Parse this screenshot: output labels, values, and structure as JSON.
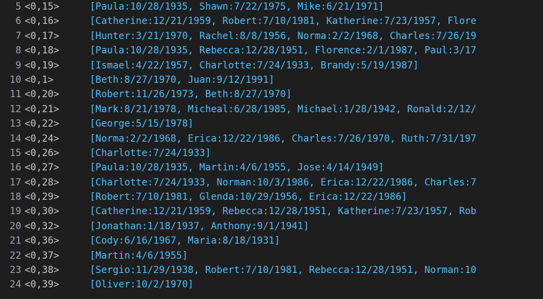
{
  "colors": {
    "background": "#1e1e1e",
    "line_number": "#9da5b4",
    "key": "#c8c8c8",
    "value": "#4fc1ff"
  },
  "lines": [
    {
      "number": "5",
      "key": "<0,15>",
      "value": "[Paula:10/28/1935, Shawn:7/22/1975, Mike:6/21/1971]"
    },
    {
      "number": "6",
      "key": "<0,16>",
      "value": "[Catherine:12/21/1959, Robert:7/10/1981, Katherine:7/23/1957, Flore"
    },
    {
      "number": "7",
      "key": "<0,17>",
      "value": "[Hunter:3/21/1970, Rachel:8/8/1956, Norma:2/2/1968, Charles:7/26/19"
    },
    {
      "number": "8",
      "key": "<0,18>",
      "value": "[Paula:10/28/1935, Rebecca:12/28/1951, Florence:2/1/1987, Paul:3/17"
    },
    {
      "number": "9",
      "key": "<0,19>",
      "value": "[Ismael:4/22/1957, Charlotte:7/24/1933, Brandy:5/19/1987]"
    },
    {
      "number": "10",
      "key": "<0,1>",
      "value": "[Beth:8/27/1970, Juan:9/12/1991]"
    },
    {
      "number": "11",
      "key": "<0,20>",
      "value": "[Robert:11/26/1973, Beth:8/27/1970]"
    },
    {
      "number": "12",
      "key": "<0,21>",
      "value": "[Mark:8/21/1978, Micheal:6/28/1985, Michael:1/28/1942, Ronald:2/12/"
    },
    {
      "number": "13",
      "key": "<0,22>",
      "value": "[George:5/15/1978]"
    },
    {
      "number": "14",
      "key": "<0,24>",
      "value": "[Norma:2/2/1968, Erica:12/22/1986, Charles:7/26/1970, Ruth:7/31/197"
    },
    {
      "number": "15",
      "key": "<0,26>",
      "value": "[Charlotte:7/24/1933]"
    },
    {
      "number": "16",
      "key": "<0,27>",
      "value": "[Paula:10/28/1935, Martin:4/6/1955, Jose:4/14/1949]"
    },
    {
      "number": "17",
      "key": "<0,28>",
      "value": "[Charlotte:7/24/1933, Norman:10/3/1986, Erica:12/22/1986, Charles:7"
    },
    {
      "number": "18",
      "key": "<0,29>",
      "value": "[Robert:7/10/1981, Glenda:10/29/1956, Erica:12/22/1986]"
    },
    {
      "number": "19",
      "key": "<0,30>",
      "value": "[Catherine:12/21/1959, Rebecca:12/28/1951, Katherine:7/23/1957, Rob"
    },
    {
      "number": "20",
      "key": "<0,32>",
      "value": "[Jonathan:1/18/1937, Anthony:9/1/1941]"
    },
    {
      "number": "21",
      "key": "<0,36>",
      "value": "[Cody:6/16/1967, Maria:8/18/1931]"
    },
    {
      "number": "22",
      "key": "<0,37>",
      "value": "[Martin:4/6/1955]"
    },
    {
      "number": "23",
      "key": "<0,38>",
      "value": "[Sergio:11/29/1938, Robert:7/10/1981, Rebecca:12/28/1951, Norman:10"
    },
    {
      "number": "24",
      "key": "<0,39>",
      "value": "[Oliver:10/2/1970]"
    }
  ]
}
